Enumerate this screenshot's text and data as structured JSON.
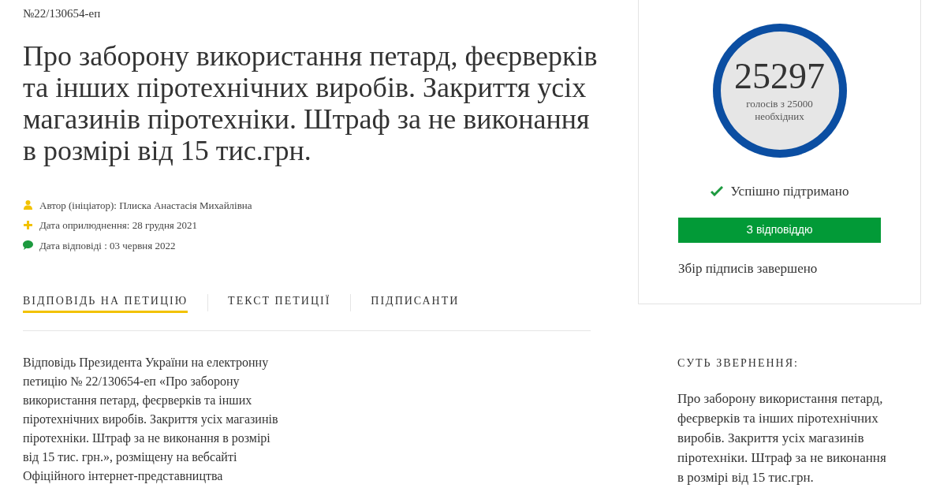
{
  "petition_number": "№22/130654-еп",
  "title": "Про заборону використання петард, феєрверків та інших піротехнічних виробів. Закриття усіх магазинів піротехніки. Штраф за не виконання в розмірі від 15 тис.грн.",
  "meta": [
    {
      "kind": "author",
      "text": "Автор (ініціатор): Плиска Анастасія Михайлівна"
    },
    {
      "kind": "published",
      "text": "Дата оприлюднення: 28 грудня 2021"
    },
    {
      "kind": "answered",
      "text": "Дата відповіді : 03 червня 2022"
    }
  ],
  "tabs": [
    {
      "label": "ВІДПОВІДЬ НА ПЕТИЦІЮ",
      "selected": true
    },
    {
      "label": "ТЕКСТ ПЕТИЦІЇ",
      "selected": false
    },
    {
      "label": "ПІДПИСАНТИ",
      "selected": false
    }
  ],
  "answer_text": "Відповідь Президента України на електронну петицію № 22/130654-еп «Про заборону використання петард, феєрверків та інших піротехнічних виробів. Закриття усіх магазинів піротехніки. Штраф за не виконання в розмірі від 15 тис. грн.», розміщену на вебсайті Офіційного інтернет-представництва",
  "votes": {
    "count": "25297",
    "caption_line_1": "голосів з 25000",
    "caption_line_2": "необхідних"
  },
  "status": "Успішно підтримано",
  "status_button": "З відповіддю",
  "collection_status": "Збір підписів завершено",
  "summary": {
    "heading": "СУТЬ ЗВЕРНЕННЯ:",
    "text": "Про заборону використання петард, феєрверків та інших піротехнічних виробів. Закриття усіх магазинів піротехніки. Штраф за не виконання в розмірі від 15 тис.грн."
  }
}
